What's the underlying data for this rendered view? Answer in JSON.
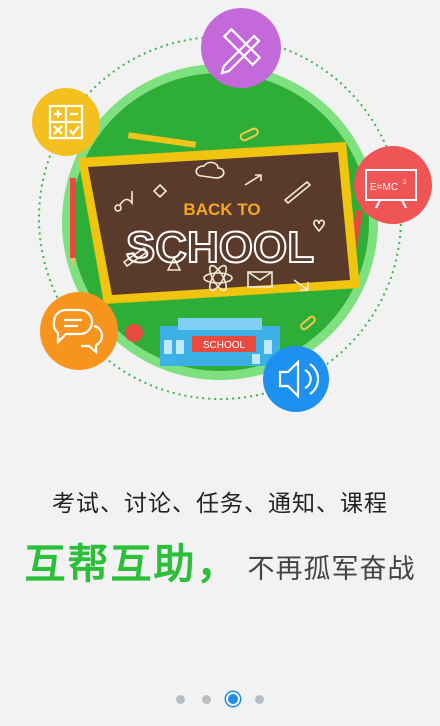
{
  "illustration": {
    "board_line1": "BACK TO",
    "board_line2": "SCHOOL",
    "building_sign": "SCHOOL",
    "formula": "E=MC",
    "formula_exp": "2",
    "icons": [
      "math-symbols-icon",
      "ruler-pencil-icon",
      "formula-icon",
      "chat-icon",
      "speaker-icon"
    ],
    "colors": {
      "ring": "#42c34a",
      "ring_inner": "#2fae37",
      "dotted_circle": "#3cb44a",
      "board_frame": "#f1c40f",
      "board": "#5a3b2b",
      "yellow_badge": "#f4c020",
      "purple_badge": "#c469d9",
      "red_badge": "#f05555",
      "orange_badge": "#f7941d",
      "blue_badge": "#1e90f0"
    }
  },
  "caption": "考试、讨论、任务、通知、课程",
  "slogan": {
    "strong": "互帮互助，",
    "soft": "不再孤军奋战"
  },
  "pager": {
    "total": 4,
    "active_index": 3
  }
}
